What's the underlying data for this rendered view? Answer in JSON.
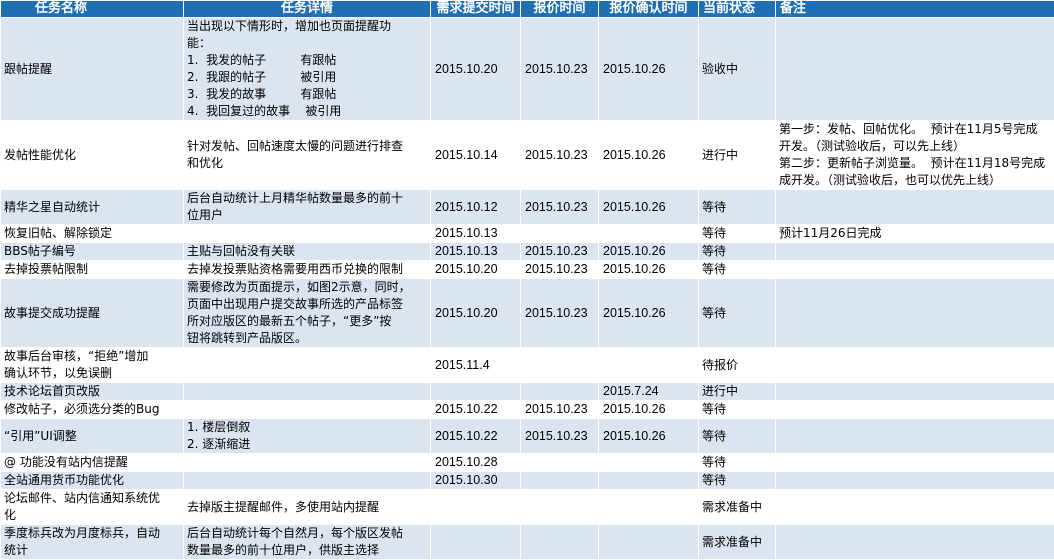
{
  "headers": {
    "task_name": "任务名称",
    "task_detail": "任务详情",
    "submit_time": "需求提交时间",
    "quote_time": "报价时间",
    "quote_confirm_time": "报价确认时间",
    "status": "当前状态",
    "remark": "备注"
  },
  "rows": [
    {
      "name": "跟帖提醒",
      "detail": "当出现以下情形时，增加也页面提醒功\n能：\n1.  我发的帖子         有跟帖\n2.  我跟的帖子         被引用\n3.  我发的故事         有跟帖\n4.  我回复过的故事    被引用",
      "submit": "2015.10.20",
      "quote": "2015.10.23",
      "confirm": "2015.10.26",
      "status": "验收中",
      "remark": ""
    },
    {
      "name": "发帖性能优化",
      "detail": "针对发帖、回帖速度太慢的问题进行排查\n和优化",
      "submit": "2015.10.14",
      "quote": "2015.10.23",
      "confirm": "2015.10.26",
      "status": "进行中",
      "remark": "第一步：发帖、回帖优化。  预计在11月5号完成\n开发。（测试验收后，可以先上线）\n第二步：更新帖子浏览量。  预计在11月18号完成\n成开发。（测试验收后，也可以优先上线）"
    },
    {
      "name": "精华之星自动统计",
      "detail": "后台自动统计上月精华帖数量最多的前十\n位用户",
      "submit": "2015.10.12",
      "quote": "2015.10.23",
      "confirm": "2015.10.26",
      "status": "等待",
      "remark": ""
    },
    {
      "name": "恢复旧帖、解除锁定",
      "detail": "",
      "submit": "2015.10.13",
      "quote": "",
      "confirm": "",
      "status": "等待",
      "remark": "预计11月26日完成"
    },
    {
      "name": "BBS帖子编号",
      "detail": "主贴与回帖没有关联",
      "submit": "2015.10.13",
      "quote": "2015.10.23",
      "confirm": "2015.10.26",
      "status": "等待",
      "remark": ""
    },
    {
      "name": "去掉投票帖限制",
      "detail": "去掉发投票贴资格需要用西币兑换的限制",
      "submit": "2015.10.20",
      "quote": "2015.10.23",
      "confirm": "2015.10.26",
      "status": "等待",
      "remark": ""
    },
    {
      "name": "故事提交成功提醒",
      "detail": "需要修改为页面提示，如图2示意，同时，\n页面中出现用户提交故事所选的产品标签\n所对应版区的最新五个帖子，“更多”按\n钮将跳转到产品版区。",
      "submit": "2015.10.20",
      "quote": "2015.10.23",
      "confirm": "2015.10.26",
      "status": "等待",
      "remark": ""
    },
    {
      "name": "故事后台审核，“拒绝”增加\n确认环节，以免误删",
      "detail": "",
      "submit": "2015.11.4",
      "quote": "",
      "confirm": "",
      "status": "待报价",
      "remark": ""
    },
    {
      "name": "技术论坛首页改版",
      "detail": "",
      "submit": "",
      "quote": "",
      "confirm": "2015.7.24",
      "status": "进行中",
      "remark": ""
    },
    {
      "name": "修改帖子，必须选分类的Bug",
      "detail": "",
      "submit": "2015.10.22",
      "quote": "2015.10.23",
      "confirm": "2015.10.26",
      "status": "等待",
      "remark": ""
    },
    {
      "name": "“引用”UI调整",
      "detail": "1. 楼层倒叙\n2. 逐渐缩进",
      "submit": "2015.10.22",
      "quote": "2015.10.23",
      "confirm": "2015.10.26",
      "status": "等待",
      "remark": ""
    },
    {
      "name": "@ 功能没有站内信提醒",
      "detail": "",
      "submit": "2015.10.28",
      "quote": "",
      "confirm": "",
      "status": "等待",
      "remark": ""
    },
    {
      "name": "全站通用货币功能优化",
      "detail": "",
      "submit": "2015.10.30",
      "quote": "",
      "confirm": "",
      "status": "等待",
      "remark": ""
    },
    {
      "name": "论坛邮件、站内信通知系统优\n化",
      "detail": "去掉版主提醒邮件，多使用站内提醒",
      "submit": "",
      "quote": "",
      "confirm": "",
      "status": "需求准备中",
      "remark": ""
    },
    {
      "name": "季度标兵改为月度标兵，自动\n统计",
      "detail": "后台自动统计每个自然月，每个版区发帖\n数量最多的前十位用户，供版主选择",
      "submit": "",
      "quote": "",
      "confirm": "",
      "status": "需求准备中",
      "remark": ""
    }
  ],
  "colors": {
    "header_bg": "#1f6fb4",
    "header_text": "#ffffff",
    "stripe_bg": "#dbe5f1",
    "plain_bg": "#ffffff"
  }
}
